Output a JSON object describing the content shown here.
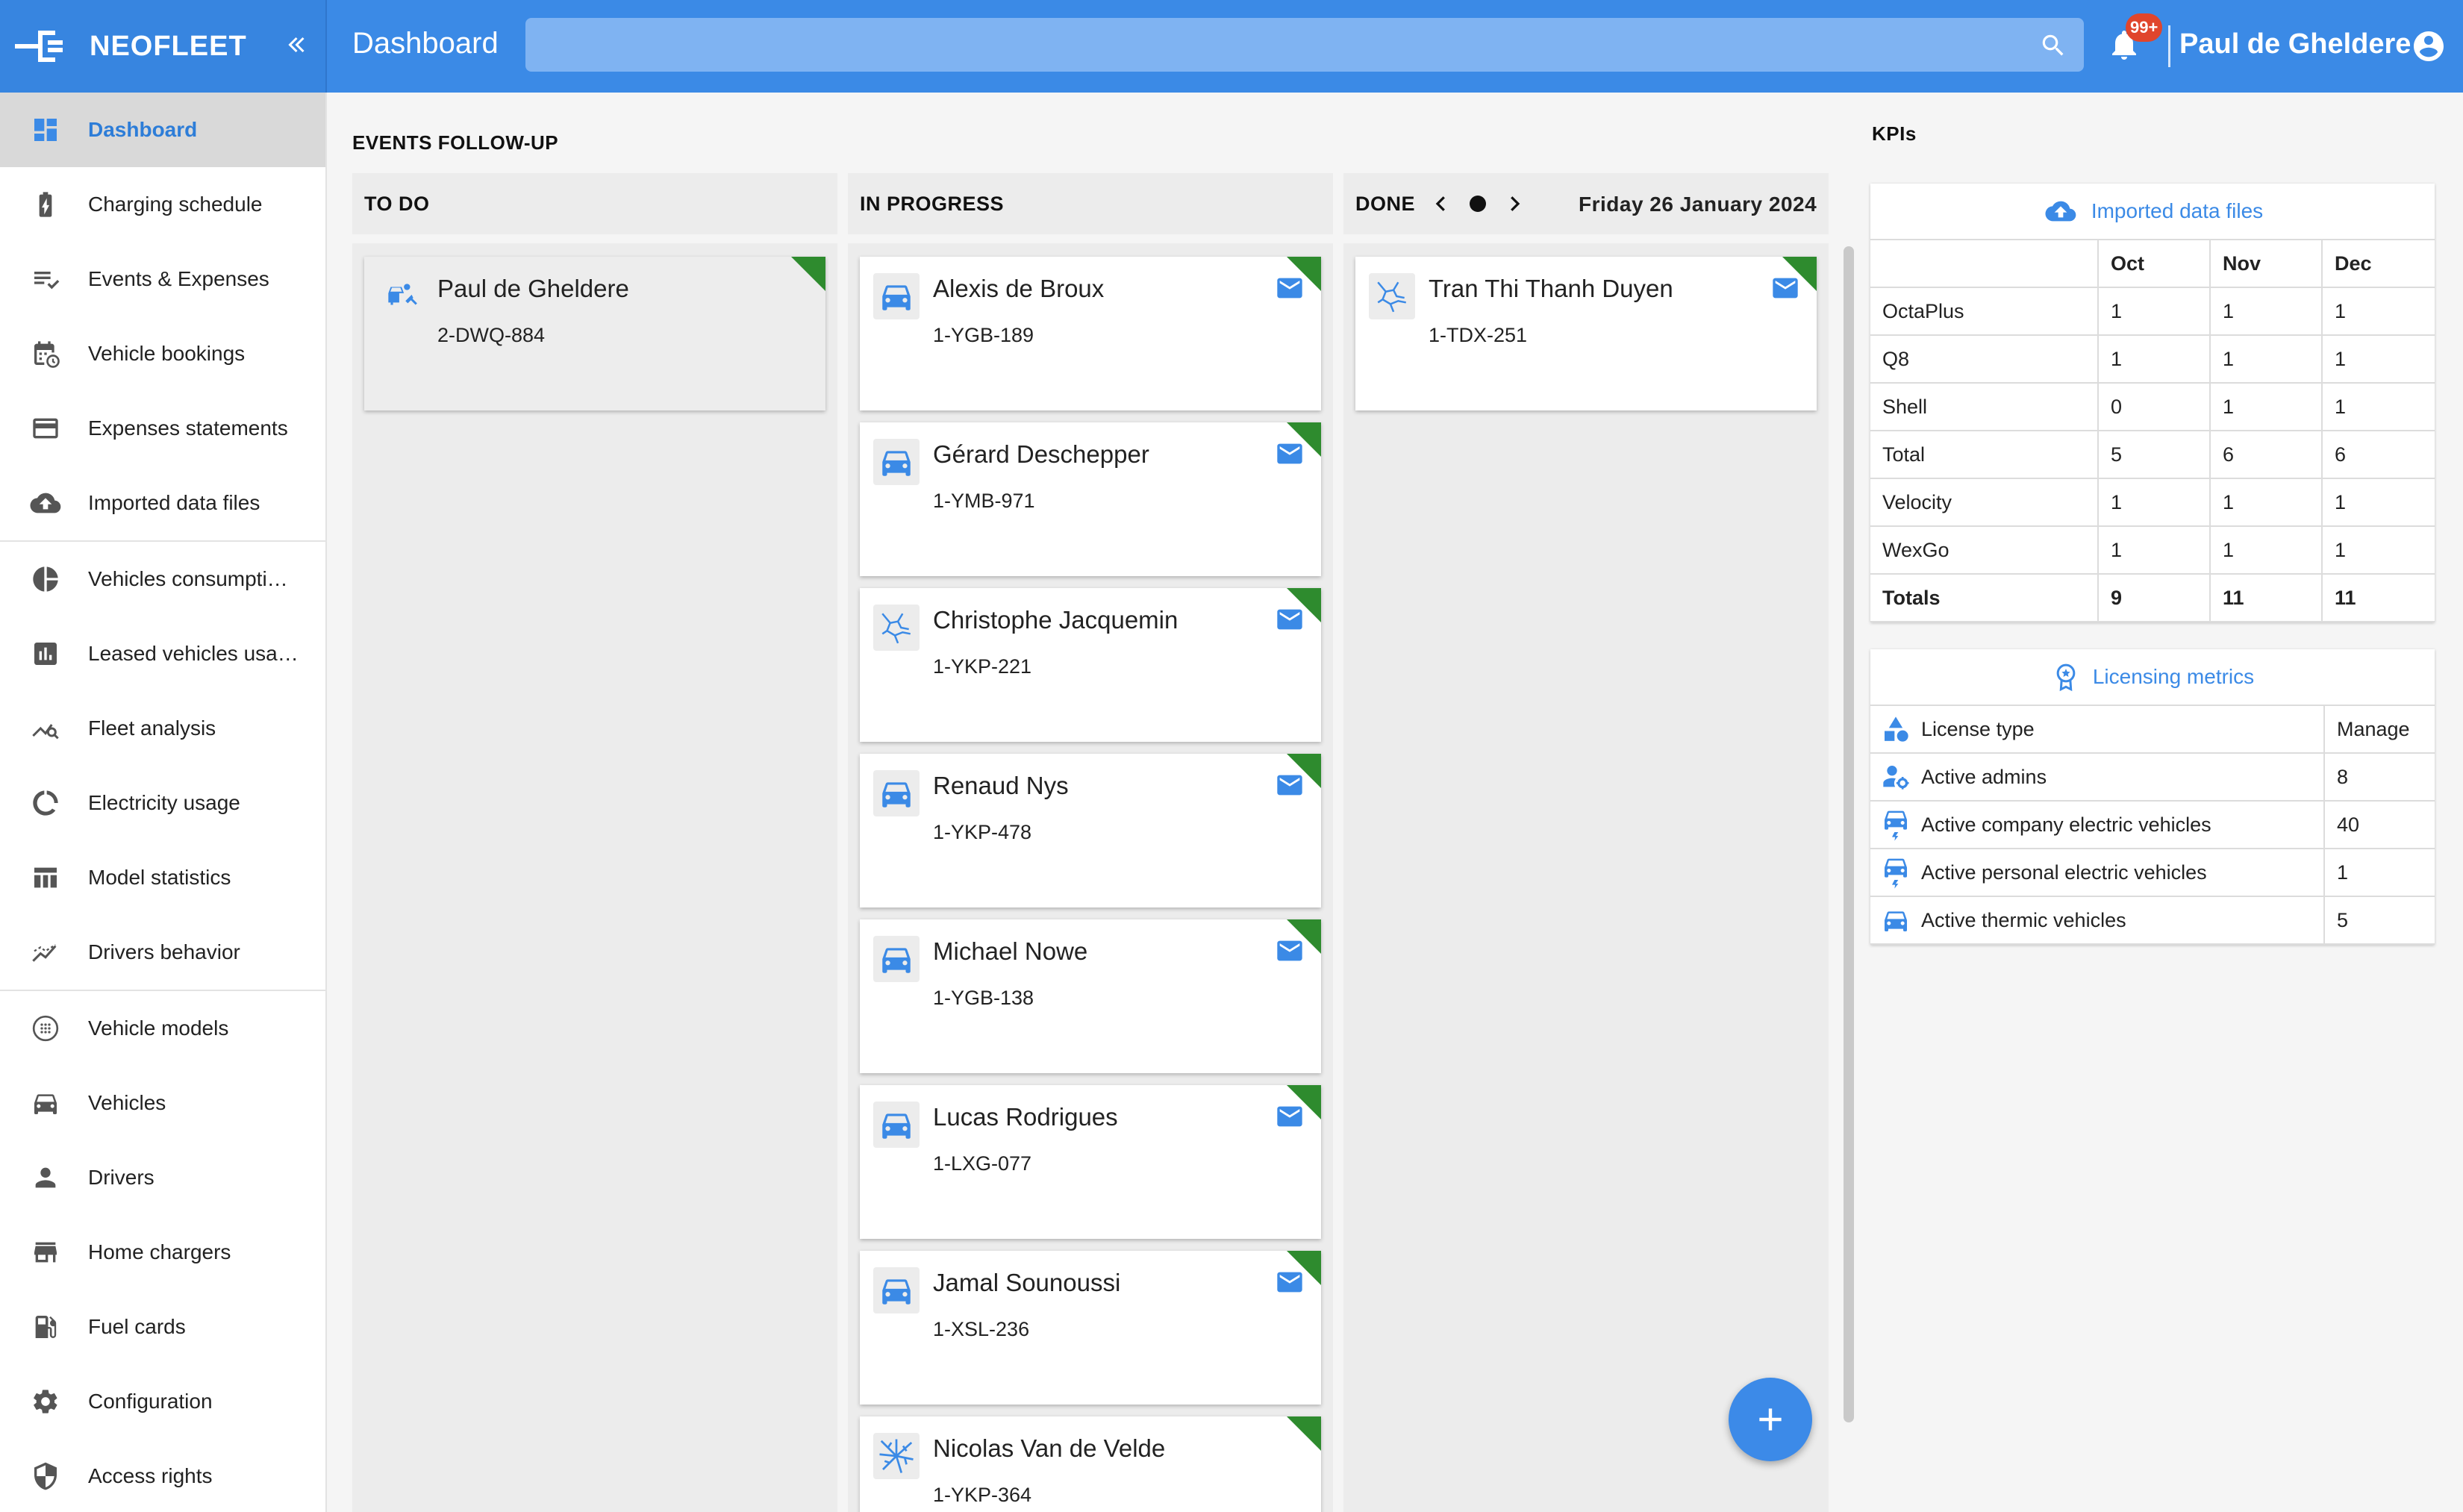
{
  "app": {
    "brand": "NEOFLEET",
    "page_title": "Dashboard",
    "search_placeholder": "",
    "notification_badge": "99+",
    "user_name": "Paul de Ghelderе",
    "accent_color": "#3b8ae6",
    "corner_flag_color": "#2e8b2e"
  },
  "sidebar": {
    "items": [
      {
        "label": "Dashboard",
        "icon": "dashboard-icon",
        "active": true
      },
      {
        "label": "Charging schedule",
        "icon": "battery-charging-icon"
      },
      {
        "label": "Events & Expenses",
        "icon": "list-check-icon"
      },
      {
        "label": "Vehicle bookings",
        "icon": "calendar-clock-icon"
      },
      {
        "label": "Expenses statements",
        "icon": "credit-card-icon"
      },
      {
        "label": "Imported data files",
        "icon": "cloud-upload-icon"
      },
      {
        "label": "Vehicles consumpti…",
        "icon": "pie-chart-icon"
      },
      {
        "label": "Leased vehicles usa…",
        "icon": "bar-chart-icon"
      },
      {
        "label": "Fleet analysis",
        "icon": "trend-search-icon"
      },
      {
        "label": "Electricity usage",
        "icon": "donut-icon"
      },
      {
        "label": "Model statistics",
        "icon": "table-icon"
      },
      {
        "label": "Drivers behavior",
        "icon": "trend-icon"
      },
      {
        "label": "Vehicle models",
        "icon": "circle-dots-icon"
      },
      {
        "label": "Vehicles",
        "icon": "car-icon"
      },
      {
        "label": "Drivers",
        "icon": "person-icon"
      },
      {
        "label": "Home chargers",
        "icon": "store-icon"
      },
      {
        "label": "Fuel cards",
        "icon": "fuel-icon"
      },
      {
        "label": "Configuration",
        "icon": "gear-icon"
      },
      {
        "label": "Access rights",
        "icon": "shield-icon"
      }
    ]
  },
  "events": {
    "title": "EVENTS FOLLOW-UP",
    "columns": {
      "todo": {
        "label": "TO DO",
        "cards": [
          {
            "name": "Paul de Ghelderе",
            "plate": "2-DWQ-884",
            "icon": "car-repair-icon"
          }
        ]
      },
      "in_progress": {
        "label": "IN PROGRESS",
        "cards": [
          {
            "name": "Alexis de Broux",
            "plate": "1-YGB-189",
            "icon": "car-icon"
          },
          {
            "name": "Gérard Deschepper",
            "plate": "1-YMB-971",
            "icon": "car-icon"
          },
          {
            "name": "Christophe Jacquemin",
            "plate": "1-YKP-221",
            "icon": "crack-icon"
          },
          {
            "name": "Renaud Nys",
            "plate": "1-YKP-478",
            "icon": "car-icon"
          },
          {
            "name": "Michael Nowe",
            "plate": "1-YGB-138",
            "icon": "car-icon"
          },
          {
            "name": "Lucas Rodrigues",
            "plate": "1-LXG-077",
            "icon": "car-icon"
          },
          {
            "name": "Jamal Sounoussi",
            "plate": "1-XSL-236",
            "icon": "car-icon"
          },
          {
            "name": "Nicolas Van de Velde",
            "plate": "1-YKP-364",
            "icon": "shatter-icon"
          }
        ]
      },
      "done": {
        "label": "DONE",
        "date": "Friday 26 January 2024",
        "cards": [
          {
            "name": "Tran Thi Thanh Duyen",
            "plate": "1-TDX-251",
            "icon": "crack-icon"
          }
        ]
      }
    }
  },
  "kpis": {
    "title": "KPIs",
    "imported": {
      "title": "Imported data files",
      "months": [
        "Oct",
        "Nov",
        "Dec"
      ],
      "rows": [
        {
          "name": "OctaPlus",
          "values": [
            "1",
            "1",
            "1"
          ]
        },
        {
          "name": "Q8",
          "values": [
            "1",
            "1",
            "1"
          ]
        },
        {
          "name": "Shell",
          "values": [
            "0",
            "1",
            "1"
          ]
        },
        {
          "name": "Total",
          "values": [
            "5",
            "6",
            "6"
          ]
        },
        {
          "name": "Velocity",
          "values": [
            "1",
            "1",
            "1"
          ]
        },
        {
          "name": "WexGo",
          "values": [
            "1",
            "1",
            "1"
          ]
        }
      ],
      "totals": {
        "name": "Totals",
        "values": [
          "9",
          "11",
          "11"
        ]
      }
    },
    "licensing": {
      "title": "Licensing metrics",
      "rows": [
        {
          "label": "License type",
          "value": "Manage",
          "icon": "shapes-icon"
        },
        {
          "label": "Active admins",
          "value": "8",
          "icon": "admin-gear-icon"
        },
        {
          "label": "Active company electric vehicles",
          "value": "40",
          "icon": "electric-car-icon"
        },
        {
          "label": "Active personal electric vehicles",
          "value": "1",
          "icon": "electric-car-icon"
        },
        {
          "label": "Active thermic vehicles",
          "value": "5",
          "icon": "car-icon"
        }
      ]
    }
  }
}
